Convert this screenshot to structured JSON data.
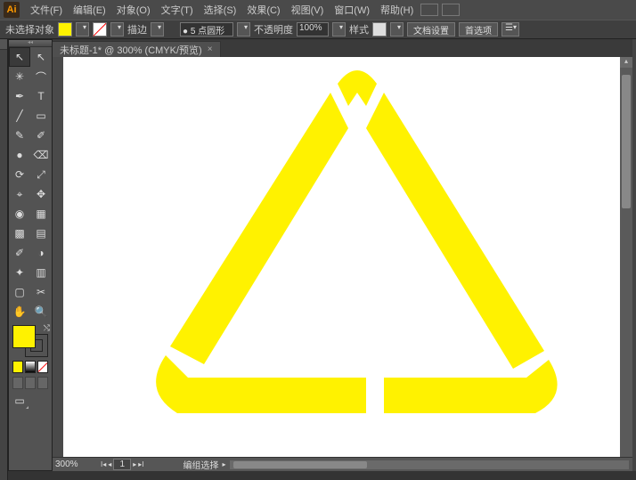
{
  "app": {
    "initials": "Ai"
  },
  "menu": {
    "file": "文件(F)",
    "edit": "编辑(E)",
    "object": "对象(O)",
    "type": "文字(T)",
    "select": "选择(S)",
    "effect": "效果(C)",
    "view": "视图(V)",
    "window": "窗口(W)",
    "help": "帮助(H)"
  },
  "options": {
    "noselection": "未选择对象",
    "stroke_label": "描边",
    "stroke_value": "5 点圆形",
    "opacity_label": "不透明度",
    "opacity_value": "100%",
    "style_label": "样式",
    "docsetup": "文档设置",
    "prefs": "首选项"
  },
  "doc": {
    "tab_title": "未标题-1* @ 300% (CMYK/预览)"
  },
  "status": {
    "zoom": "300%",
    "page": "1",
    "mode": "编组选择"
  },
  "colors": {
    "fill": "#fff200",
    "artboard": "#ffffff"
  },
  "tool_icons": {
    "selection": "↖",
    "direct": "↖",
    "wand": "✳",
    "lasso": "⌒",
    "pen": "✒",
    "type": "T",
    "line": "╱",
    "rect": "▭",
    "brush": "✎",
    "pencil": "✐",
    "blob": "●",
    "eraser": "⌫",
    "rotate": "⟳",
    "scale": "⤢",
    "width": "⌖",
    "free": "✥",
    "shape": "◉",
    "perspective": "▦",
    "mesh": "▩",
    "gradient": "▤",
    "eyedrop": "✐",
    "blend": "◑",
    "spray": "✦",
    "graph": "▥",
    "artboard": "▢",
    "slice": "✂",
    "hand": "✋",
    "zoomt": "🔍"
  }
}
